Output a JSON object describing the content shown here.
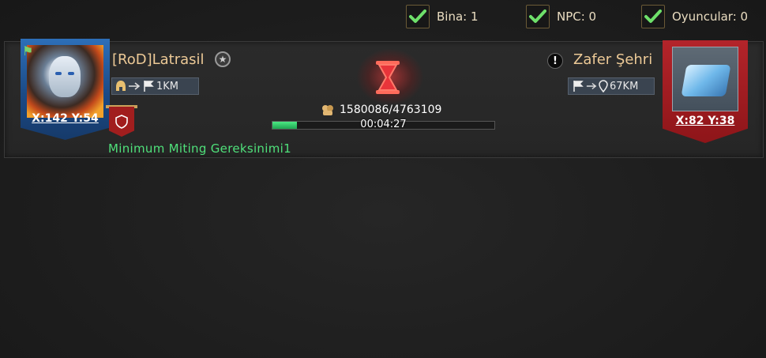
{
  "filters": [
    {
      "label": "Bina: 1",
      "checked": true
    },
    {
      "label": "NPC: 0",
      "checked": true
    },
    {
      "label": "Oyuncular: 0",
      "checked": true
    }
  ],
  "rally": {
    "player": {
      "name": "[RoD]Latrasil",
      "coords": "X:142 Y:54",
      "distance": "1KM"
    },
    "requirement": "Minimum Miting Gereksinimi1",
    "troops": "1580086/4763109",
    "progress": 0.11,
    "timer": "00:04:27",
    "target": {
      "name": "Zafer Şehri",
      "coords": "X:82 Y:38",
      "distance": "67KM"
    }
  },
  "colors": {
    "accent_gold": "#ecc996",
    "requirement_green": "#4fe07a",
    "progress_green": "#2fc766",
    "banner_red": "#a11e1e"
  }
}
